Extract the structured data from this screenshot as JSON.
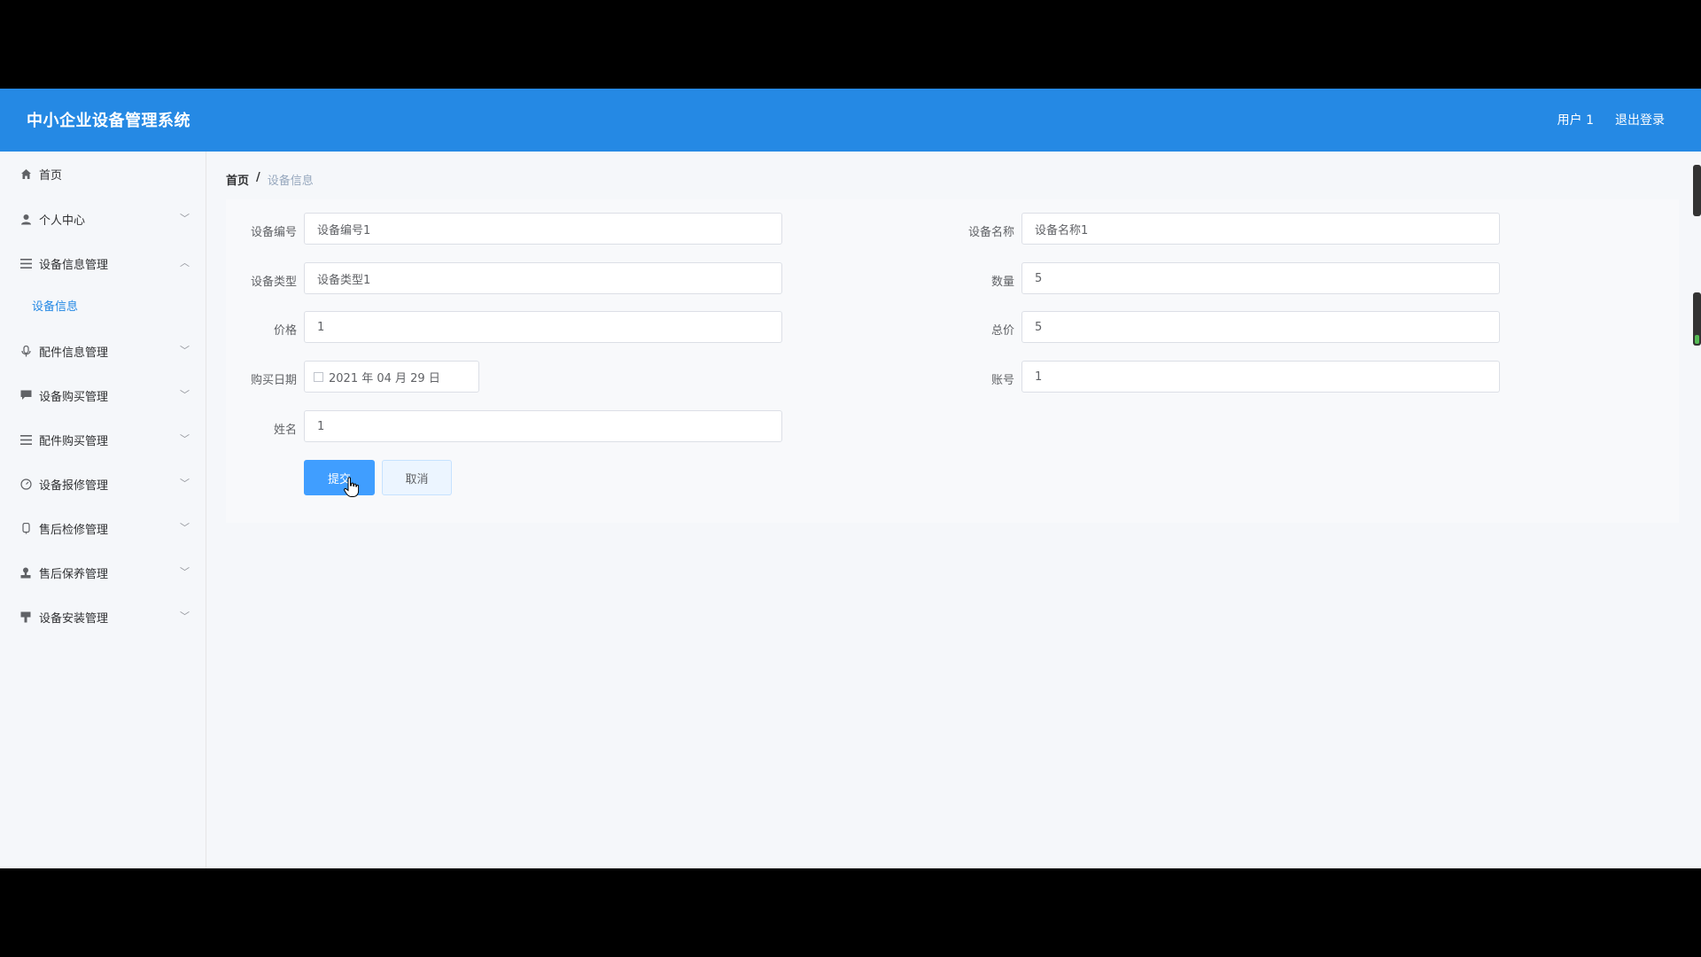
{
  "header": {
    "title": "中小企业设备管理系统",
    "user": "用户 1",
    "logout": "退出登录"
  },
  "sidebar": {
    "items": [
      {
        "label": "首页",
        "icon": "home-icon"
      },
      {
        "label": "个人中心",
        "icon": "user-icon"
      },
      {
        "label": "设备信息管理",
        "icon": "menu-icon",
        "expanded": true
      },
      {
        "label": "配件信息管理",
        "icon": "microphone-icon"
      },
      {
        "label": "设备购买管理",
        "icon": "comment-icon"
      },
      {
        "label": "配件购买管理",
        "icon": "menu-icon"
      },
      {
        "label": "设备报修管理",
        "icon": "gauge-icon"
      },
      {
        "label": "售后检修管理",
        "icon": "stopwatch-icon"
      },
      {
        "label": "售后保养管理",
        "icon": "stamp-icon"
      },
      {
        "label": "设备安装管理",
        "icon": "brush-icon"
      }
    ],
    "subitem": "设备信息"
  },
  "breadcrumb": {
    "home": "首页",
    "separator": "/",
    "current": "设备信息"
  },
  "form": {
    "equip_no_label": "设备编号",
    "equip_no_value": "设备编号1",
    "equip_name_label": "设备名称",
    "equip_name_value": "设备名称1",
    "equip_type_label": "设备类型",
    "equip_type_value": "设备类型1",
    "quantity_label": "数量",
    "quantity_value": "5",
    "price_label": "价格",
    "price_value": "1",
    "total_label": "总价",
    "total_value": "5",
    "date_label": "购买日期",
    "date_value": "2021 年 04 月 29 日",
    "account_label": "账号",
    "account_value": "1",
    "name_label": "姓名",
    "name_value": "1",
    "submit": "提交",
    "cancel": "取消"
  },
  "colors": {
    "header_bg": "#2589e4",
    "primary": "#409eff"
  }
}
